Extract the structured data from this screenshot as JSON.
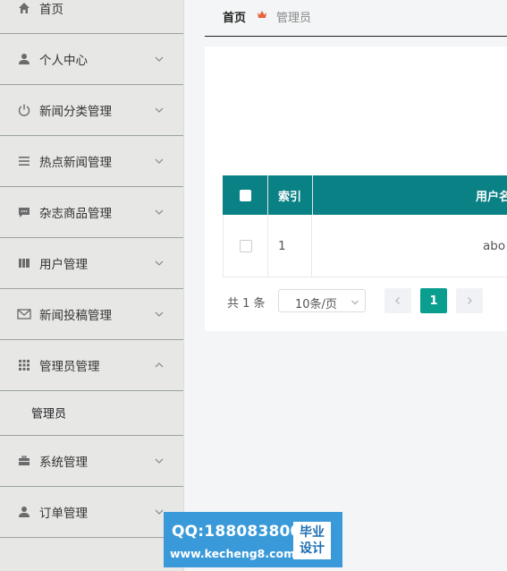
{
  "sidebar": {
    "items": [
      {
        "label": "首页",
        "icon": "home-icon"
      },
      {
        "label": "个人中心",
        "icon": "user-icon"
      },
      {
        "label": "新闻分类管理",
        "icon": "power-icon"
      },
      {
        "label": "热点新闻管理",
        "icon": "list-icon"
      },
      {
        "label": "杂志商品管理",
        "icon": "chat-icon"
      },
      {
        "label": "用户管理",
        "icon": "book-icon"
      },
      {
        "label": "新闻投稿管理",
        "icon": "mail-icon"
      },
      {
        "label": "管理员管理",
        "icon": "grid-icon"
      },
      {
        "label": "系统管理",
        "icon": "briefcase-icon"
      },
      {
        "label": "订单管理",
        "icon": "user-icon"
      }
    ],
    "submenu": {
      "label": "管理员"
    }
  },
  "breadcrumb": {
    "home": "首页",
    "current": "管理员"
  },
  "table": {
    "headers": {
      "index": "索引",
      "user": "用户名"
    },
    "rows": [
      {
        "index": "1",
        "user": "abo"
      }
    ]
  },
  "pagination": {
    "total": "共 1 条",
    "page_size": "10条/页",
    "current_page": "1"
  },
  "watermark": {
    "qq": "QQ:188083800",
    "url": "www.kecheng8.com",
    "badge_line1": "毕业",
    "badge_line2": "设计"
  },
  "colors": {
    "header_teal": "#0a8185",
    "active_page": "#0a9e8f",
    "sidebar_bg": "#e7e7e6"
  }
}
